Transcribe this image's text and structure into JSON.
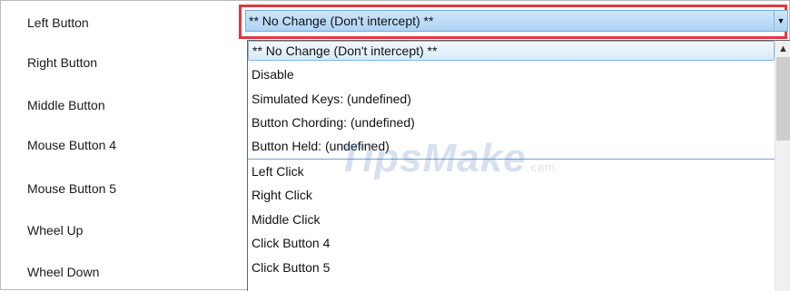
{
  "labels": [
    "Left Button",
    "Right Button",
    "Middle Button",
    "Mouse Button 4",
    "Mouse Button 5",
    "Wheel Up",
    "Wheel Down"
  ],
  "combo": {
    "value": "** No Change (Don't intercept) **",
    "arrow_icon": "dropdown-arrow-icon",
    "highlight_color": "#e0383e"
  },
  "options": [
    "** No Change (Don't intercept) **",
    "Disable",
    "Simulated Keys: (undefined)",
    "Button Chording: (undefined)",
    "Button Held: (undefined)",
    "Left Click",
    "Right Click",
    "Middle Click",
    "Click Button 4",
    "Click Button 5"
  ],
  "selected_option": 0,
  "watermark": {
    "text": "TipsMake",
    "suffix": ".com"
  }
}
